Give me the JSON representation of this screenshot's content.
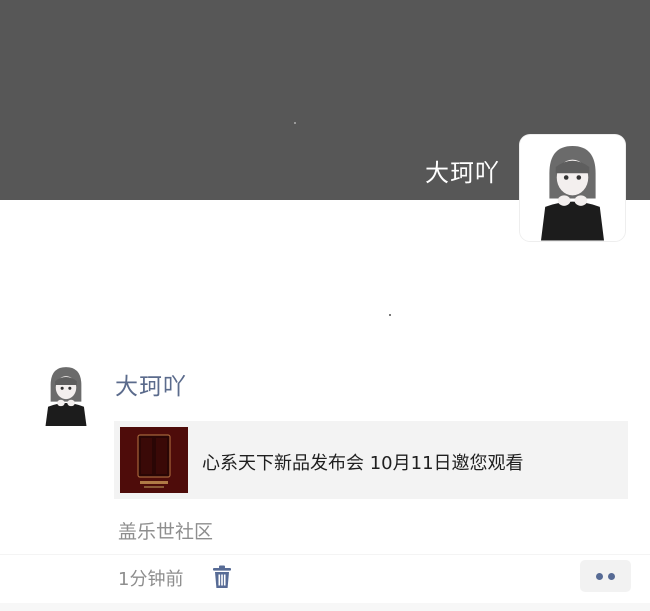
{
  "cover": {
    "user_name": "大珂吖"
  },
  "post": {
    "author": "大珂吖",
    "share_card": {
      "title": "心系天下新品发布会 10月11日邀您观看"
    },
    "source": "盖乐世社区",
    "time": "1分钟前"
  },
  "icons": {
    "delete": "trash-icon",
    "more": "more-dots-icon"
  },
  "colors": {
    "cover_bg": "#575757",
    "author_link": "#5b6b8c",
    "card_bg": "#f3f3f3",
    "meta_text": "#8e8e8e"
  }
}
